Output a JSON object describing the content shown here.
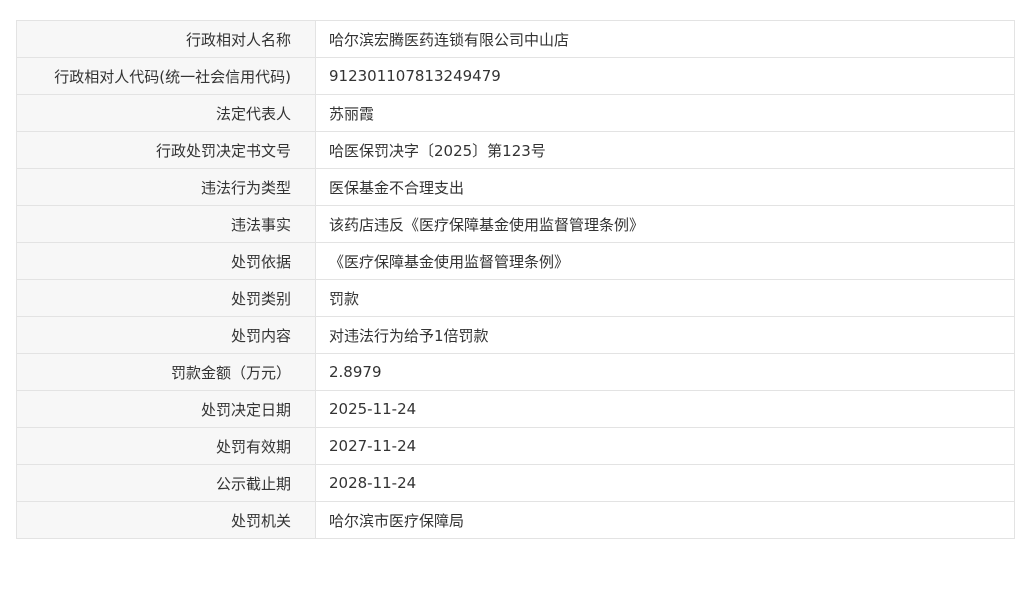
{
  "rows": [
    {
      "label": "行政相对人名称",
      "value": "哈尔滨宏腾医药连锁有限公司中山店"
    },
    {
      "label": "行政相对人代码(统一社会信用代码)",
      "value": "912301107813249479"
    },
    {
      "label": "法定代表人",
      "value": "苏丽霞"
    },
    {
      "label": "行政处罚决定书文号",
      "value": "哈医保罚决字〔2025〕第123号"
    },
    {
      "label": "违法行为类型",
      "value": "医保基金不合理支出"
    },
    {
      "label": "违法事实",
      "value": "该药店违反《医疗保障基金使用监督管理条例》"
    },
    {
      "label": "处罚依据",
      "value": "《医疗保障基金使用监督管理条例》"
    },
    {
      "label": "处罚类别",
      "value": "罚款"
    },
    {
      "label": "处罚内容",
      "value": "对违法行为给予1倍罚款"
    },
    {
      "label": "罚款金额（万元）",
      "value": "2.8979"
    },
    {
      "label": "处罚决定日期",
      "value": "2025-11-24"
    },
    {
      "label": "处罚有效期",
      "value": "2027-11-24"
    },
    {
      "label": "公示截止期",
      "value": "2028-11-24"
    },
    {
      "label": "处罚机关",
      "value": "哈尔滨市医疗保障局"
    }
  ]
}
